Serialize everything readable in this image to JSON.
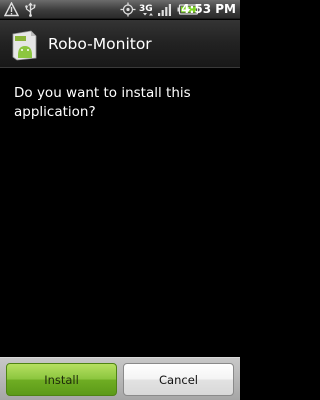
{
  "status_bar": {
    "time": "4:53",
    "time_suffix": "PM",
    "network": "3G",
    "icons": [
      "warning-icon",
      "usb-icon",
      "gps-icon",
      "3g-icon",
      "signal-icon",
      "battery-icon"
    ]
  },
  "header": {
    "title": "Robo-Monitor",
    "icon": "android-package-icon"
  },
  "dialog": {
    "prompt": "Do you want to install this application?"
  },
  "buttons": {
    "install_label": "Install",
    "cancel_label": "Cancel"
  },
  "colors": {
    "install_button": "#8cc63f",
    "background": "#000000"
  }
}
